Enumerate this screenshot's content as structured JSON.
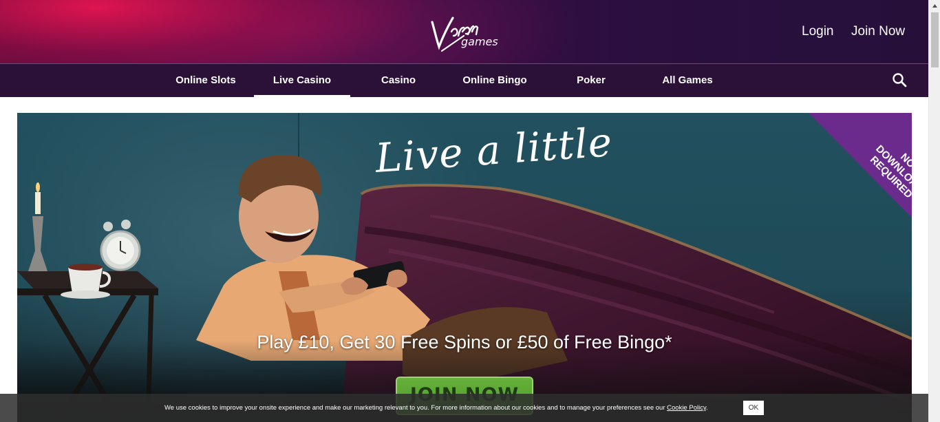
{
  "header": {
    "logo_text": "Virgin games",
    "login_label": "Login",
    "join_label": "Join Now"
  },
  "nav": {
    "items": [
      {
        "label": "Online Slots"
      },
      {
        "label": "Live Casino",
        "active": true
      },
      {
        "label": "Casino"
      },
      {
        "label": "Online Bingo"
      },
      {
        "label": "Poker"
      },
      {
        "label": "All Games"
      }
    ],
    "search_icon": "search-icon"
  },
  "hero": {
    "title": "Live a little",
    "badge_lines": [
      "NO",
      "DOWNLOAD",
      "REQUIRED"
    ],
    "offer": "Play £10, Get 30 Free Spins or £50 of Free Bingo*",
    "cta_label": "JOIN NOW"
  },
  "cookie": {
    "text": "We use cookies to improve your onsite experience and make our marketing relevant to you. For more information about our cookies and to manage your preferences see our ",
    "link_text": "Cookie Policy",
    "suffix": ".",
    "ok_label": "OK"
  },
  "colors": {
    "nav_bg": "#2b1037",
    "badge": "#6a2b8c",
    "cta_green": "#5aa533",
    "hero_wall": "#22505e"
  }
}
